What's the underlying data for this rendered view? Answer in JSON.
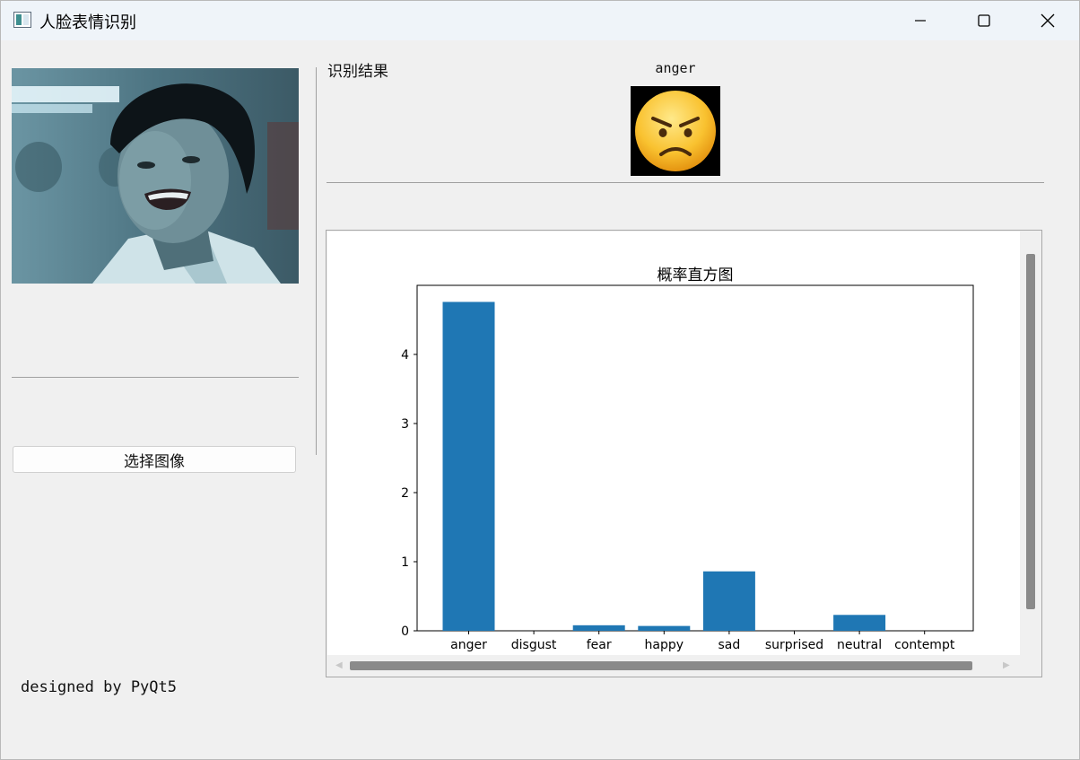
{
  "window": {
    "title": "人脸表情识别",
    "controls": [
      "minimize-icon",
      "maximize-icon",
      "close-icon"
    ]
  },
  "left_panel": {
    "select_button_label": "选择图像",
    "footer_text": "designed by PyQt5"
  },
  "right_panel": {
    "result_label": "识别结果",
    "emotion": "anger",
    "emoji_icon": "angry-face-icon"
  },
  "colors": {
    "bar": "#1f77b4",
    "background": "#f0f0f0",
    "titlebar": "#eff4f9"
  },
  "chart_data": {
    "type": "bar",
    "title": "概率直方图",
    "categories": [
      "anger",
      "disgust",
      "fear",
      "happy",
      "sad",
      "surprised",
      "neutral",
      "contempt"
    ],
    "values": [
      4.76,
      0.0,
      0.08,
      0.07,
      0.86,
      0.0,
      0.23,
      0.0
    ],
    "yticks": [
      0,
      1,
      2,
      3,
      4
    ],
    "ylim": [
      0,
      5.0
    ],
    "xlabel": "",
    "ylabel": "",
    "grid": false
  }
}
